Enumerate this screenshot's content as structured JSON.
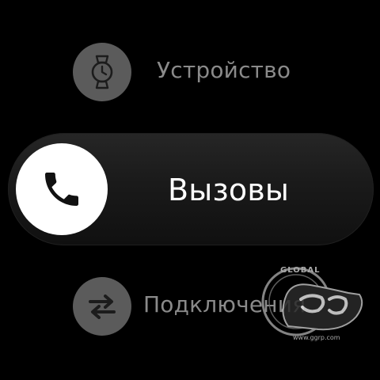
{
  "menu": {
    "items": [
      {
        "label": "Устройство",
        "icon": "watch-icon",
        "focused": false
      },
      {
        "label": "Вызовы",
        "icon": "phone-icon",
        "focused": true
      },
      {
        "label": "Подключения",
        "icon": "swap-arrows-icon",
        "focused": false
      }
    ]
  },
  "watermark": {
    "brand": "GLOBAL",
    "site": "www.ggrp.com"
  },
  "colors": {
    "background": "#000000",
    "icon_inactive": "#5b5b5b",
    "icon_active": "#ffffff",
    "label_inactive": "#8a8a8a",
    "label_active": "#ffffff"
  }
}
